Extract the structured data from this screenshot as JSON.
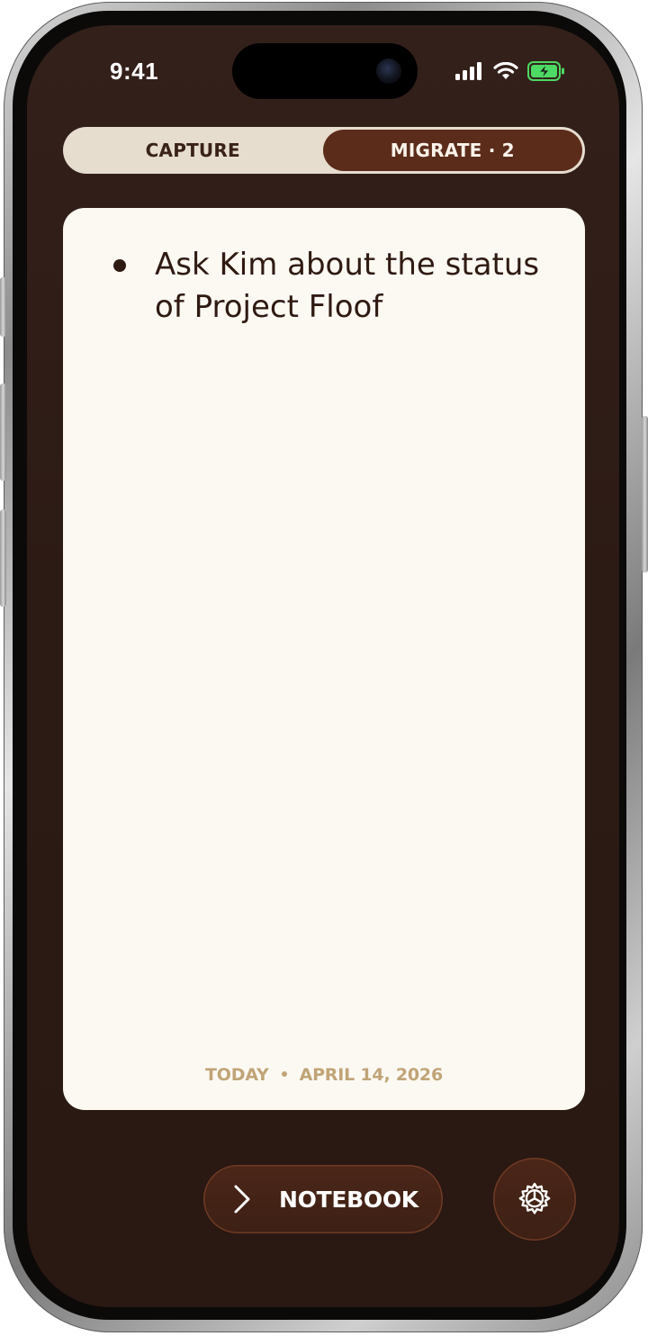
{
  "status_bar": {
    "time": "9:41",
    "icons": [
      "cellular-signal-icon",
      "wifi-icon",
      "battery-charging-icon"
    ]
  },
  "tabs": [
    {
      "label": "CAPTURE",
      "selected": false
    },
    {
      "label": "MIGRATE · 2",
      "selected": true
    }
  ],
  "note": {
    "items": [
      {
        "text": "Ask Kim about the status of Project Floof"
      }
    ]
  },
  "footer": {
    "day": "TODAY",
    "date": "APRIL 14, 2026"
  },
  "bottom_bar": {
    "notebook_label": "NOTEBOOK",
    "notebook_icon": "chevron-right-icon",
    "settings_icon": "gear-icon"
  },
  "colors": {
    "background": "#2c1a14",
    "accent": "#5c2c1b",
    "card": "#fcf9f3",
    "footer_text": "#c1a477",
    "battery_green": "#4cd964"
  }
}
